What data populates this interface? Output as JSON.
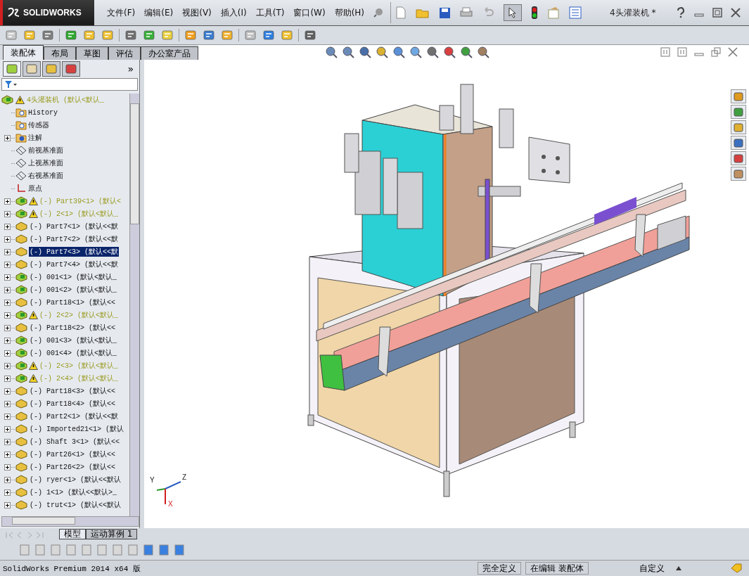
{
  "window": {
    "brand": "SOLIDWORKS",
    "title": "4头灌装机 *"
  },
  "menu": [
    "文件(F)",
    "编辑(E)",
    "视图(V)",
    "插入(I)",
    "工具(T)",
    "窗口(W)",
    "帮助(H)"
  ],
  "command_tabs": [
    {
      "label": "装配体",
      "selected": true
    },
    {
      "label": "布局",
      "selected": false
    },
    {
      "label": "草图",
      "selected": false
    },
    {
      "label": "评估",
      "selected": false
    },
    {
      "label": "办公室产品",
      "selected": false
    }
  ],
  "panel": {
    "more": "»"
  },
  "tree": [
    {
      "label": "4头灌装机 (默认<默认_",
      "kind": "assembly",
      "warning": true,
      "children": [
        {
          "label": "History",
          "kind": "history",
          "warning": false,
          "expandable": false,
          "selected": false
        },
        {
          "label": "传感器",
          "kind": "sensor",
          "warning": false,
          "expandable": false,
          "selected": false
        },
        {
          "label": "注解",
          "kind": "annotation",
          "warning": false,
          "expandable": true,
          "selected": false
        },
        {
          "label": "前视基准面",
          "kind": "plane",
          "warning": false,
          "expandable": false,
          "selected": false
        },
        {
          "label": "上视基准面",
          "kind": "plane",
          "warning": false,
          "expandable": false,
          "selected": false
        },
        {
          "label": "右视基准面",
          "kind": "plane",
          "warning": false,
          "expandable": false,
          "selected": false
        },
        {
          "label": "原点",
          "kind": "origin",
          "warning": false,
          "expandable": false,
          "selected": false
        },
        {
          "label": "(-) Part39<1> (默认<",
          "kind": "assembly",
          "warning": true,
          "expandable": true,
          "selected": false
        },
        {
          "label": "(-) 2<1> (默认<默认_",
          "kind": "assembly",
          "warning": true,
          "expandable": true,
          "selected": false
        },
        {
          "label": "(-) Part7<1> (默认<<默",
          "kind": "part",
          "warning": false,
          "expandable": true,
          "selected": false
        },
        {
          "label": "(-) Part7<2> (默认<<默",
          "kind": "part",
          "warning": false,
          "expandable": true,
          "selected": false
        },
        {
          "label": "(-) Part7<3> (默认<<默",
          "kind": "part",
          "warning": false,
          "expandable": true,
          "selected": true
        },
        {
          "label": "(-) Part7<4> (默认<<默",
          "kind": "part",
          "warning": false,
          "expandable": true,
          "selected": false
        },
        {
          "label": "(-) 001<1> (默认<默认_",
          "kind": "assembly",
          "warning": false,
          "expandable": true,
          "selected": false
        },
        {
          "label": "(-) 001<2> (默认<默认_",
          "kind": "assembly",
          "warning": false,
          "expandable": true,
          "selected": false
        },
        {
          "label": "(-) Part18<1> (默认<<",
          "kind": "part",
          "warning": false,
          "expandable": true,
          "selected": false
        },
        {
          "label": "(-) 2<2> (默认<默认_",
          "kind": "assembly",
          "warning": true,
          "expandable": true,
          "selected": false
        },
        {
          "label": "(-) Part18<2> (默认<<",
          "kind": "part",
          "warning": false,
          "expandable": true,
          "selected": false
        },
        {
          "label": "(-) 001<3> (默认<默认_",
          "kind": "assembly",
          "warning": false,
          "expandable": true,
          "selected": false
        },
        {
          "label": "(-) 001<4> (默认<默认_",
          "kind": "assembly",
          "warning": false,
          "expandable": true,
          "selected": false
        },
        {
          "label": "(-) 2<3> (默认<默认_",
          "kind": "assembly",
          "warning": true,
          "expandable": true,
          "selected": false
        },
        {
          "label": "(-) 2<4> (默认<默认_",
          "kind": "assembly",
          "warning": true,
          "expandable": true,
          "selected": false
        },
        {
          "label": "(-) Part18<3> (默认<<",
          "kind": "part",
          "warning": false,
          "expandable": true,
          "selected": false
        },
        {
          "label": "(-) Part18<4> (默认<<",
          "kind": "part",
          "warning": false,
          "expandable": true,
          "selected": false
        },
        {
          "label": "(-) Part2<1> (默认<<默",
          "kind": "part",
          "warning": false,
          "expandable": true,
          "selected": false
        },
        {
          "label": "(-) Imported21<1> (默认",
          "kind": "part",
          "warning": false,
          "expandable": true,
          "selected": false
        },
        {
          "label": "(-) Shaft 3<1> (默认<<",
          "kind": "part",
          "warning": false,
          "expandable": true,
          "selected": false
        },
        {
          "label": "(-) Part26<1> (默认<<",
          "kind": "part",
          "warning": false,
          "expandable": true,
          "selected": false
        },
        {
          "label": "(-) Part26<2> (默认<<",
          "kind": "part",
          "warning": false,
          "expandable": true,
          "selected": false
        },
        {
          "label": "(-) ryer<1> (默认<<默认",
          "kind": "part",
          "warning": false,
          "expandable": true,
          "selected": false
        },
        {
          "label": "(-) 1<1> (默认<<默认>_",
          "kind": "part",
          "warning": false,
          "expandable": true,
          "selected": false
        },
        {
          "label": "(-) trut<1> (默认<<默认",
          "kind": "part",
          "warning": false,
          "expandable": true,
          "selected": false
        }
      ]
    }
  ],
  "triad": {
    "y": "Y",
    "z": "Z",
    "x": "X"
  },
  "bottom_tabs": [
    {
      "label": "模型",
      "selected": true
    },
    {
      "label": "运动算例 1",
      "selected": false
    }
  ],
  "status_bar": {
    "version": "SolidWorks Premium 2014 x64 版",
    "state": "完全定义",
    "mode": "在编辑 装配体",
    "units": "自定义"
  }
}
